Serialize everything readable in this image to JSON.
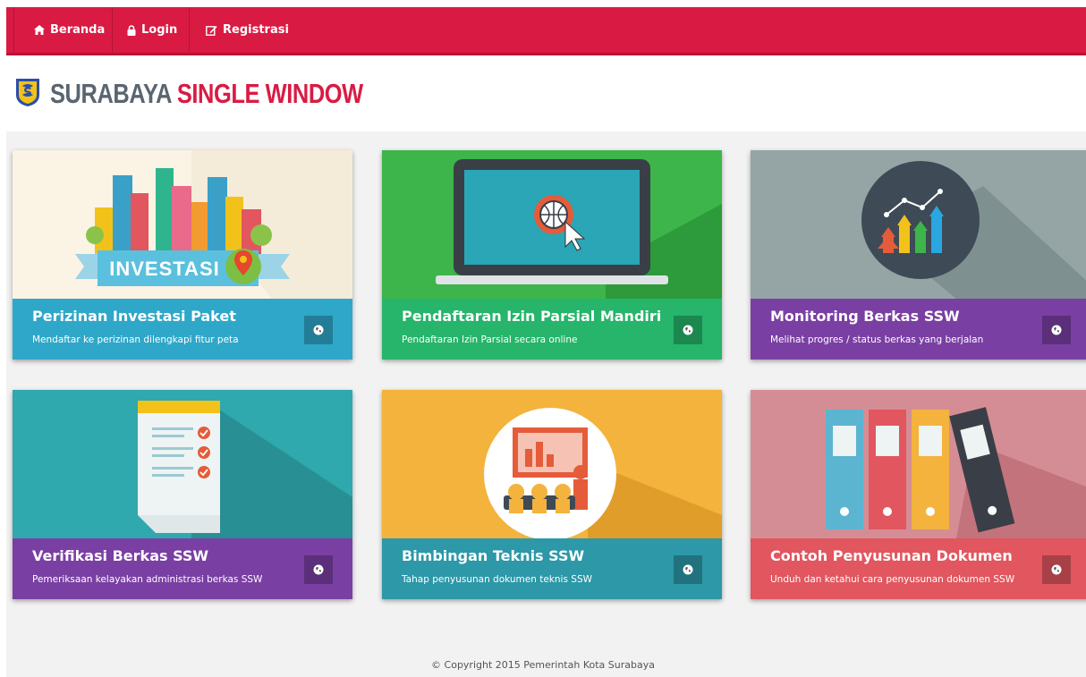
{
  "nav": {
    "home_label": "Beranda",
    "login_label": "Login",
    "register_label": "Registrasi"
  },
  "brand": {
    "part1": "SURABAYA",
    "part2": "SINGLE WINDOW"
  },
  "cards": [
    {
      "title": "Perizinan Investasi Paket",
      "subtitle": "Mendaftar ke perizinan dilengkapi fitur peta",
      "art_text": "INVESTASI",
      "color": "#2fa7c9"
    },
    {
      "title": "Pendaftaran Izin Parsial Mandiri",
      "subtitle": "Pendaftaran Izin Parsial secara online",
      "color": "#26b56a"
    },
    {
      "title": "Monitoring Berkas SSW",
      "subtitle": "Melihat progres / status berkas yang berjalan",
      "color": "#7a3fa3"
    },
    {
      "title": "Verifikasi Berkas SSW",
      "subtitle": "Pemeriksaan kelayakan administrasi berkas SSW",
      "color": "#7a3fa3"
    },
    {
      "title": "Bimbingan Teknis SSW",
      "subtitle": "Tahap penyusunan dokumen teknis SSW",
      "color": "#2c98a8"
    },
    {
      "title": "Contoh Penyusunan Dokumen",
      "subtitle": "Unduh dan ketahui cara penyusunan dokumen SSW",
      "color": "#e1565f"
    }
  ],
  "footer": {
    "copyright": "© Copyright 2015 Pemerintah Kota Surabaya"
  }
}
